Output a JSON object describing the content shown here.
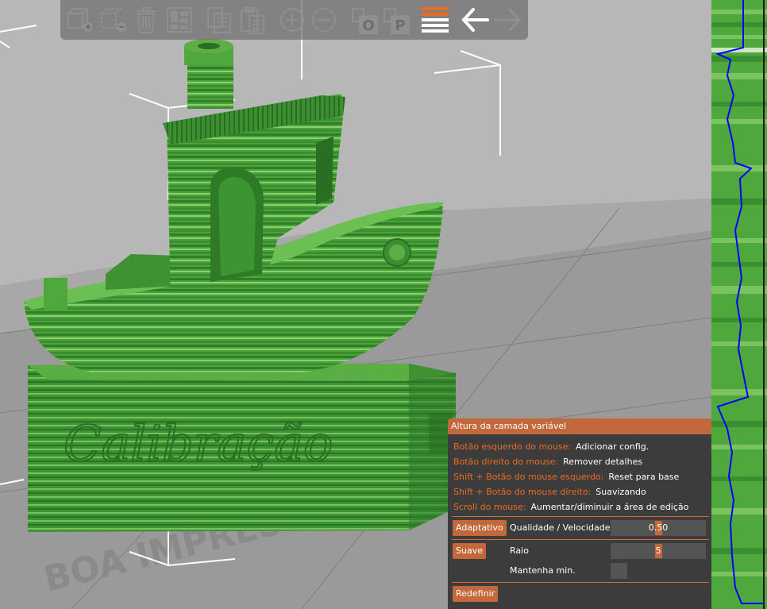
{
  "toolbar": {
    "buttons": [
      {
        "name": "add-object-icon"
      },
      {
        "name": "delete-object-icon"
      },
      {
        "name": "delete-all-icon"
      },
      {
        "name": "arrange-icon"
      },
      {
        "name": "copy-icon"
      },
      {
        "name": "paste-icon"
      },
      {
        "name": "add-instance-icon"
      },
      {
        "name": "remove-instance-icon"
      },
      {
        "name": "split-to-objects-icon"
      },
      {
        "name": "split-to-parts-icon"
      },
      {
        "name": "variable-layer-height-icon"
      },
      {
        "name": "undo-arrow-icon"
      },
      {
        "name": "redo-arrow-icon"
      }
    ],
    "split_objects_letter": "O",
    "split_parts_letter": "P"
  },
  "model": {
    "embossed_text": "Calibração",
    "bed_text": "BOA IMPRESS"
  },
  "dialog": {
    "title": "Altura da camada variável",
    "hints": [
      {
        "key": "Botão esquerdo do mouse:",
        "value": "Adicionar config."
      },
      {
        "key": "Botão direito do mouse:",
        "value": "Remover detalhes"
      },
      {
        "key": "Shift + Botão do mouse esquerdo:",
        "value": "Reset para base"
      },
      {
        "key": "Shift + Botão do mouse direito:",
        "value": "Suavizando"
      },
      {
        "key": "Scroll do mouse:",
        "value": "Aumentar/diminuir a área de edição"
      }
    ],
    "adaptive_button": "Adaptativo",
    "quality_label": "Qualidade / Velocidade",
    "quality_value": "0.50",
    "quality_fraction": 0.5,
    "smooth_button": "Suave",
    "radius_label": "Raio",
    "radius_value": "5",
    "radius_fraction": 0.5,
    "keep_min_label": "Mantenha min.",
    "reset_button": "Redefinir"
  },
  "colors": {
    "accent": "#c2683a",
    "hint_key": "#ed6b21",
    "model_green": "#4ea83c",
    "profile_line": "#0000ff"
  }
}
